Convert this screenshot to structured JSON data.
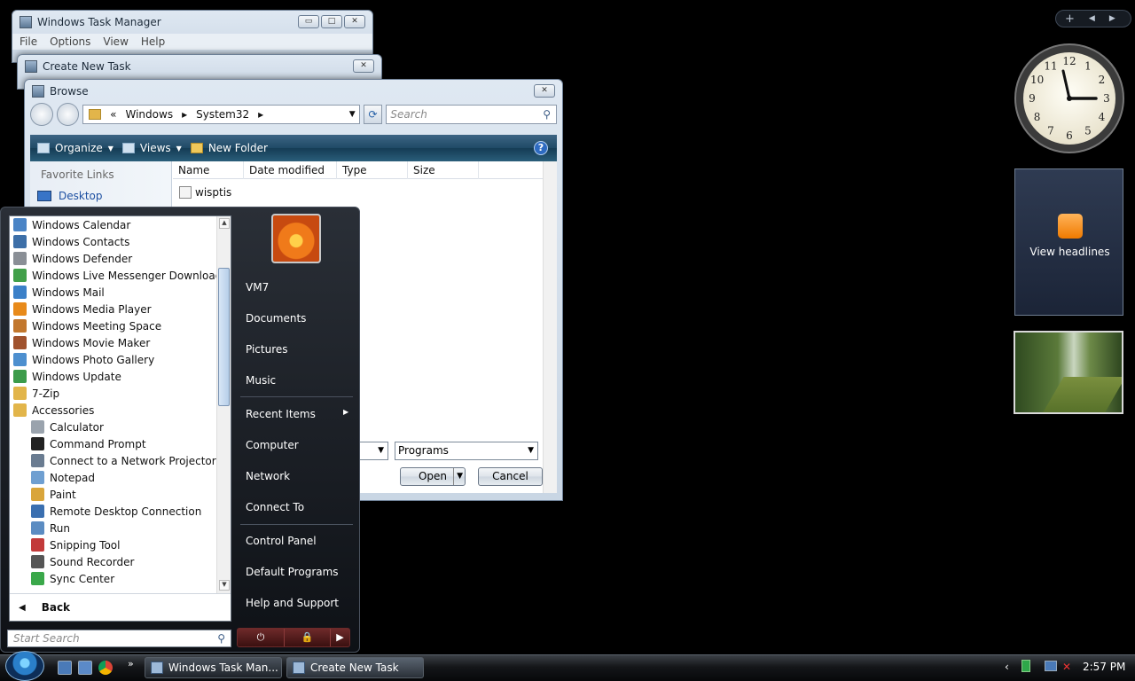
{
  "task_manager": {
    "title": "Windows Task Manager",
    "menu": [
      "File",
      "Options",
      "View",
      "Help"
    ],
    "buttons": [
      "▭",
      "□",
      "✕"
    ]
  },
  "create_task": {
    "title": "Create New Task",
    "close": "✕"
  },
  "browse": {
    "title": "Browse",
    "close": "✕",
    "address": [
      "«",
      "Windows",
      "▸",
      "System32",
      "▸"
    ],
    "search_placeholder": "Search",
    "commands": [
      "Organize",
      "Views",
      "New Folder"
    ],
    "favorites_label": "Favorite Links",
    "favorites": [
      "Desktop"
    ],
    "columns": [
      "Name",
      "Date modified",
      "Type",
      "Size"
    ],
    "files": [
      "wisptis"
    ],
    "file_type": "Programs",
    "open_label": "Open",
    "cancel_label": "Cancel"
  },
  "start_menu": {
    "programs": [
      {
        "label": "Windows Calendar",
        "level": 0,
        "color": "#4a84c6"
      },
      {
        "label": "Windows Contacts",
        "level": 0,
        "color": "#3d6fa8"
      },
      {
        "label": "Windows Defender",
        "level": 0,
        "color": "#8a8f96"
      },
      {
        "label": "Windows Live Messenger Download",
        "level": 0,
        "color": "#42a04a"
      },
      {
        "label": "Windows Mail",
        "level": 0,
        "color": "#3b80c8"
      },
      {
        "label": "Windows Media Player",
        "level": 0,
        "color": "#e88a1a"
      },
      {
        "label": "Windows Meeting Space",
        "level": 0,
        "color": "#c2772d"
      },
      {
        "label": "Windows Movie Maker",
        "level": 0,
        "color": "#a0522d"
      },
      {
        "label": "Windows Photo Gallery",
        "level": 0,
        "color": "#4d8fcf"
      },
      {
        "label": "Windows Update",
        "level": 0,
        "color": "#3c9b4a"
      },
      {
        "label": "7-Zip",
        "level": 0,
        "color": "#e2b54a"
      },
      {
        "label": "Accessories",
        "level": 0,
        "color": "#e2b54a"
      },
      {
        "label": "Calculator",
        "level": 1,
        "color": "#9aa3ad"
      },
      {
        "label": "Command Prompt",
        "level": 1,
        "color": "#222222"
      },
      {
        "label": "Connect to a Network Projector",
        "level": 1,
        "color": "#6a7c91"
      },
      {
        "label": "Notepad",
        "level": 1,
        "color": "#6f9fd1"
      },
      {
        "label": "Paint",
        "level": 1,
        "color": "#d9a53b"
      },
      {
        "label": "Remote Desktop Connection",
        "level": 1,
        "color": "#3a6fb0"
      },
      {
        "label": "Run",
        "level": 1,
        "color": "#5b8cc2"
      },
      {
        "label": "Snipping Tool",
        "level": 1,
        "color": "#c23a3a"
      },
      {
        "label": "Sound Recorder",
        "level": 1,
        "color": "#555555"
      },
      {
        "label": "Sync Center",
        "level": 1,
        "color": "#3aa84a"
      }
    ],
    "back_label": "Back",
    "search_placeholder": "Start Search",
    "right_links": [
      "VM7",
      "Documents",
      "Pictures",
      "Music",
      "Recent Items",
      "Computer",
      "Network",
      "Connect To",
      "Control Panel",
      "Default Programs",
      "Help and Support"
    ]
  },
  "gadgets": {
    "clock_numbers": [
      "12",
      "1",
      "2",
      "3",
      "4",
      "5",
      "6",
      "7",
      "8",
      "9",
      "10",
      "11"
    ],
    "feed_label": "View headlines"
  },
  "taskbar": {
    "buttons": [
      "Windows Task Man...",
      "Create New Task"
    ],
    "time": "2:57 PM"
  }
}
